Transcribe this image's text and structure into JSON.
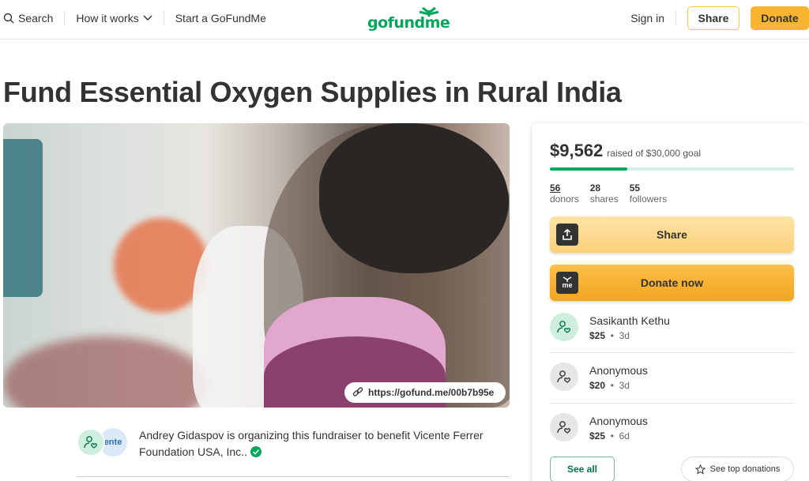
{
  "header": {
    "search_label": "Search",
    "how_it_works_label": "How it works",
    "start_label": "Start a GoFundMe",
    "logo_text": "gofundme",
    "signin_label": "Sign in",
    "share_label": "Share",
    "donate_label": "Donate"
  },
  "campaign": {
    "title": "Fund Essential Oxygen Supplies in Rural India",
    "short_link": "https://gofund.me/00b7b95e"
  },
  "sidebar": {
    "raised_amount": "$9,562",
    "raised_goal_text": "raised of $30,000 goal",
    "progress_fraction": 0.3187,
    "stats": [
      {
        "value": "56",
        "label": "donors"
      },
      {
        "value": "28",
        "label": "shares"
      },
      {
        "value": "55",
        "label": "followers"
      }
    ],
    "share_label": "Share",
    "donate_label": "Donate now",
    "donate_icon_text": "me",
    "donations": [
      {
        "name": "Sasikanth Kethu",
        "amount": "$25",
        "time": "3d"
      },
      {
        "name": "Anonymous",
        "amount": "$20",
        "time": "3d"
      },
      {
        "name": "Anonymous",
        "amount": "$25",
        "time": "6d"
      }
    ],
    "see_all_label": "See all",
    "see_top_label": "See top donations"
  },
  "organizer": {
    "text": "Andrey Gidaspov is organizing this fundraiser to benefit Vicente Ferrer Foundation USA, Inc..",
    "logo_text": "ente"
  },
  "colors": {
    "brand_green": "#02a95c",
    "donate_yellow": "#f9b530"
  }
}
